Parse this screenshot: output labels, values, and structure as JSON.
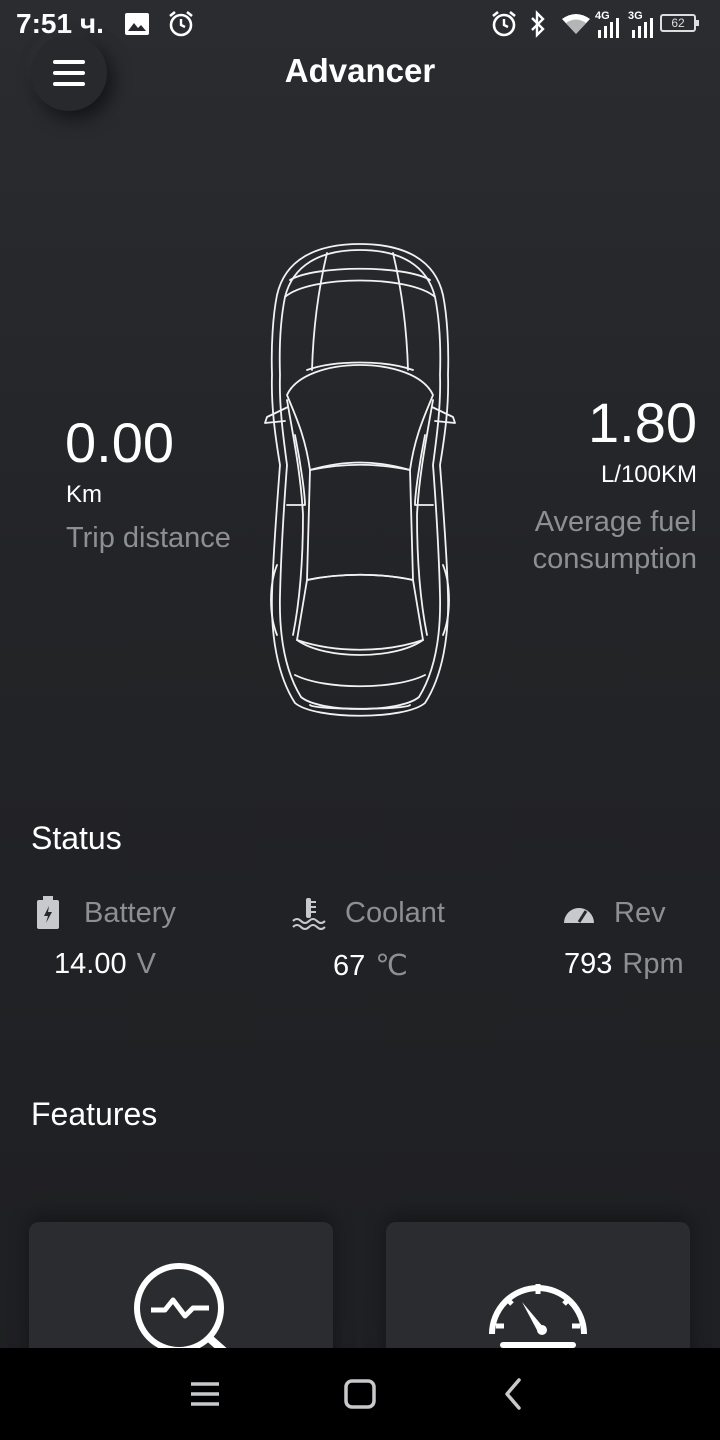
{
  "status_bar": {
    "time": "7:51 ч.",
    "network_4g": "4G",
    "network_3g": "3G",
    "battery_level": "62"
  },
  "app_bar": {
    "title": "Advancer",
    "menu_icon": "menu-icon"
  },
  "dashboard": {
    "trip": {
      "value": "0.00",
      "unit": "Km",
      "label": "Trip distance"
    },
    "fuel": {
      "value": "1.80",
      "unit": "L/100KM",
      "label": "Average fuel consumption"
    }
  },
  "status": {
    "title": "Status",
    "items": [
      {
        "icon": "battery-icon",
        "label": "Battery",
        "value": "14.00",
        "unit": "V"
      },
      {
        "icon": "coolant-icon",
        "label": "Coolant",
        "value": "67",
        "unit": "℃"
      },
      {
        "icon": "speedometer-icon",
        "label": "Rev",
        "value": "793",
        "unit": "Rpm"
      }
    ]
  },
  "features": {
    "title": "Features",
    "cards": [
      {
        "icon": "diagnostics-icon"
      },
      {
        "icon": "gauge-icon"
      }
    ]
  },
  "nav_bar": {
    "buttons": [
      "recents-icon",
      "home-icon",
      "back-icon"
    ]
  }
}
